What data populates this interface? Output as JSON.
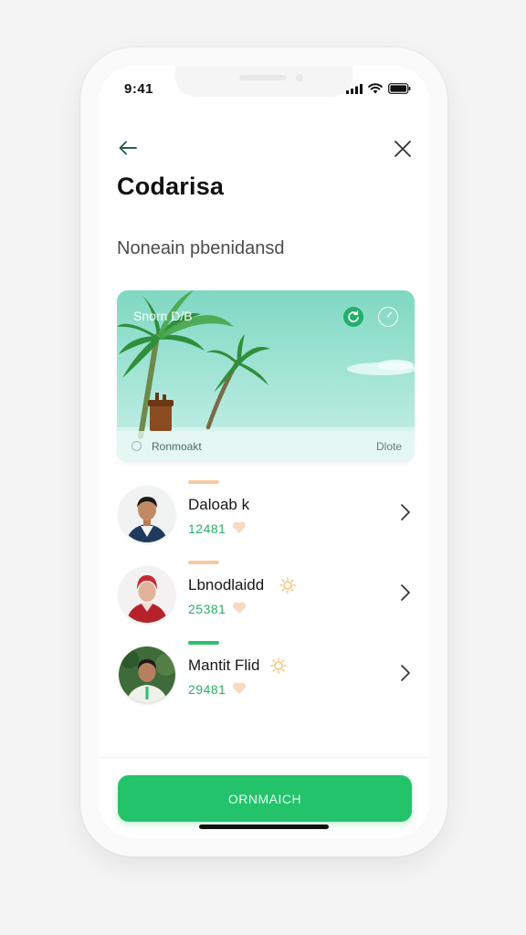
{
  "status_bar": {
    "time": "9:41"
  },
  "header": {
    "title": "Codarisa",
    "subtitle": "Noneain pbenidansd"
  },
  "card": {
    "label": "Snorn D/B",
    "footer_text": "Ronmoakt",
    "footer_right": "Dlote"
  },
  "contacts": [
    {
      "name": "Daloab k",
      "number": "12481",
      "bar_color": "#f7c9a2"
    },
    {
      "name": "Lbnodlaidd",
      "number": "25381",
      "bar_color": "#f7c9a2"
    },
    {
      "name": "Mantit Flid",
      "number": "29481",
      "bar_color": "#2cbf6f"
    }
  ],
  "cta": {
    "label": "ORNMAICH"
  },
  "colors": {
    "accent": "#22c36b",
    "number": "#2cae6a",
    "heart": "#f8d9c4",
    "sun": "#f6c67b"
  },
  "icons": {
    "back": "arrow-left-icon",
    "close": "close-icon",
    "card_action_1": "refresh-icon",
    "card_action_2": "clock-icon",
    "chevron": "chevron-right-icon",
    "heart": "heart-icon",
    "sun": "sun-icon"
  }
}
